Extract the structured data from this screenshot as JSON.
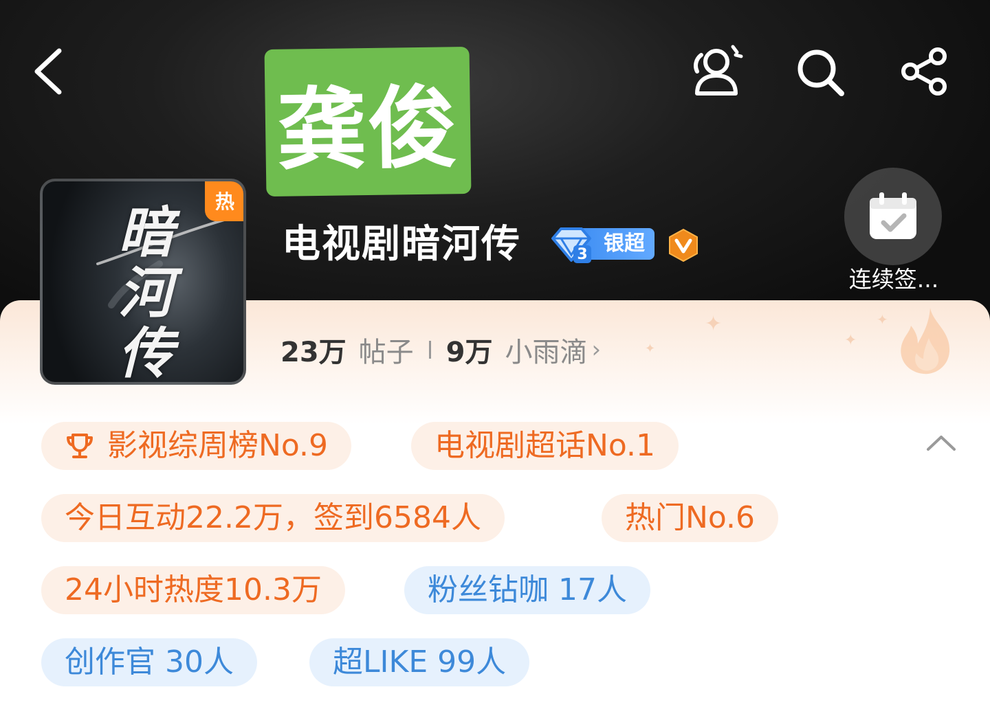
{
  "header": {
    "back_icon": "chevron-left-icon",
    "actions": [
      {
        "name": "members-icon"
      },
      {
        "name": "search-icon"
      },
      {
        "name": "share-icon"
      }
    ]
  },
  "sticker": {
    "text": "龚俊",
    "color": "#6fbd4f"
  },
  "topic": {
    "hot_tag": "热",
    "poster_text": "暗河传",
    "title": "电视剧暗河传",
    "tier_label": "银超",
    "tier_level": "3",
    "verified_icon": "v-verified-icon"
  },
  "checkin": {
    "icon": "calendar-check-icon",
    "label": "连续签..."
  },
  "stats": {
    "posts_count": "23万",
    "posts_label": "帖子",
    "fans_count": "9万",
    "fans_label": "小雨滴",
    "chevron": "›"
  },
  "tags": {
    "rank_weekly": "影视综周榜No.9",
    "rank_tv": "电视剧超话No.1",
    "today": "今日互动22.2万，签到6584人",
    "hot": "热门No.6",
    "heat_24h": "24小时热度10.3万",
    "fans_diamond": "粉丝钻咖 17人",
    "creators": "创作官 30人",
    "super_like": "超LIKE 99人"
  },
  "colors": {
    "accent_orange": "#ee6a22",
    "accent_blue": "#3d89d9",
    "hot_orange": "#ff8a1d"
  }
}
